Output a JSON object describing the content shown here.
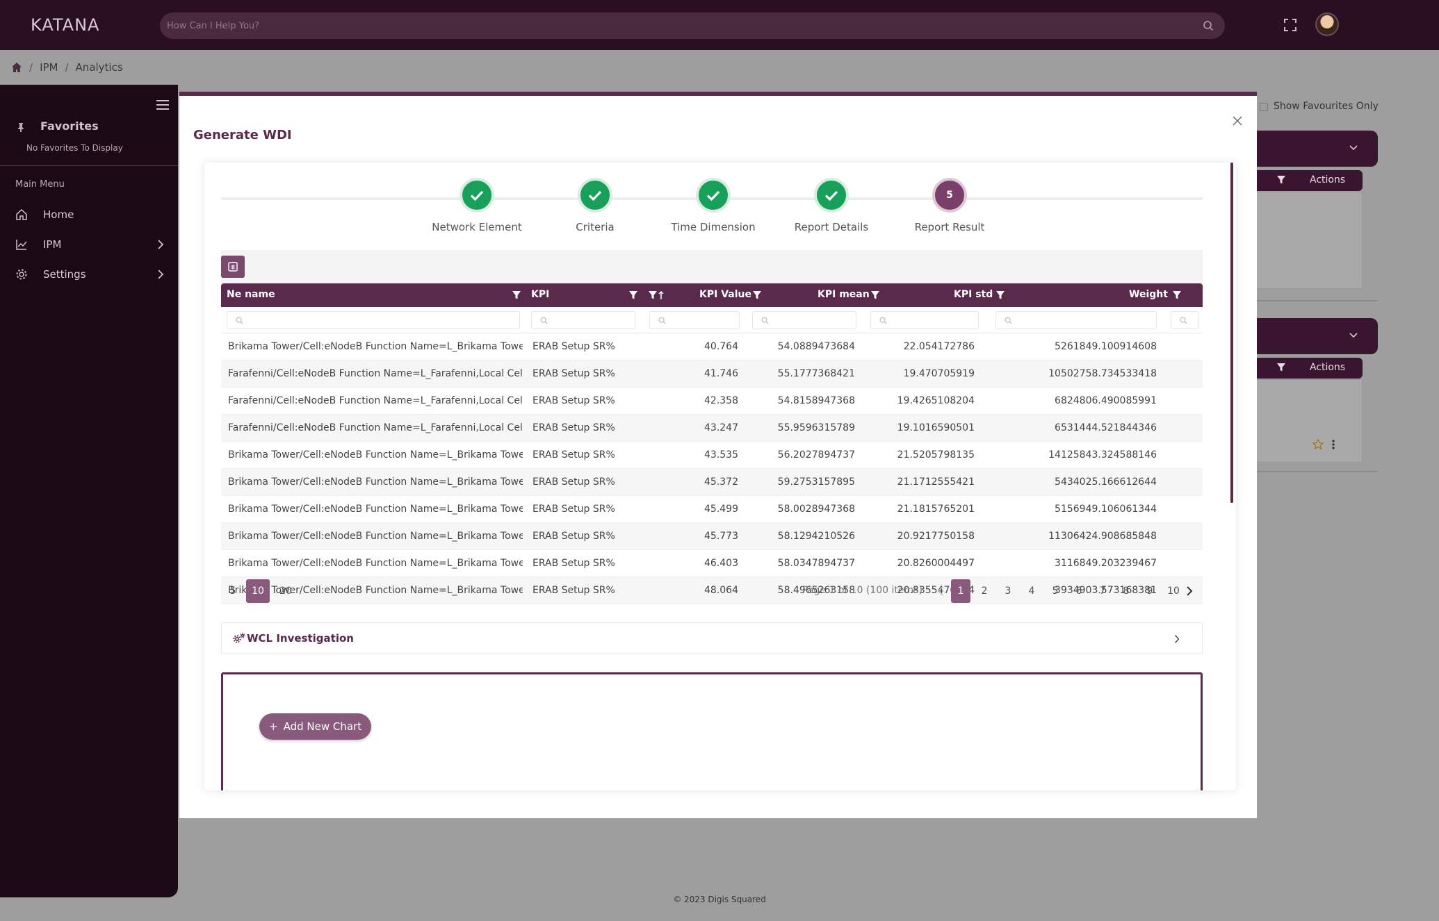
{
  "app": {
    "logo": "KATANA"
  },
  "search": {
    "placeholder": "How Can I Help You?"
  },
  "breadcrumb": {
    "items": [
      "IPM",
      "Analytics"
    ]
  },
  "sidebar": {
    "favorites_title": "Favorites",
    "favorites_empty": "No Favorites To Display",
    "main_menu_label": "Main Menu",
    "items": [
      {
        "label": "Home"
      },
      {
        "label": "IPM"
      },
      {
        "label": "Settings"
      }
    ]
  },
  "background": {
    "show_favourites_label": "Show Favourites Only",
    "actions_label": "Actions"
  },
  "modal": {
    "title": "Generate WDI",
    "steps": [
      {
        "label": "Network Element",
        "status": "done"
      },
      {
        "label": "Criteria",
        "status": "done"
      },
      {
        "label": "Time Dimension",
        "status": "done"
      },
      {
        "label": "Report Details",
        "status": "done"
      },
      {
        "label": "Report Result",
        "status": "current",
        "number": "5"
      }
    ],
    "table": {
      "columns": [
        "Ne name",
        "KPI",
        "KPI Value",
        "KPI mean",
        "KPI std",
        "Weight"
      ],
      "rows": [
        [
          "Brikama Tower/Cell:eNodeB Function Name=L_Brikama Tower,...",
          "ERAB Setup SR%",
          "40.764",
          "54.0889473684",
          "22.054172786",
          "5261849.100914608"
        ],
        [
          "Farafenni/Cell:eNodeB Function Name=L_Farafenni,Local Cell I...",
          "ERAB Setup SR%",
          "41.746",
          "55.1777368421",
          "19.470705919",
          "10502758.734533418"
        ],
        [
          "Farafenni/Cell:eNodeB Function Name=L_Farafenni,Local Cell I...",
          "ERAB Setup SR%",
          "42.358",
          "54.8158947368",
          "19.4265108204",
          "6824806.490085991"
        ],
        [
          "Farafenni/Cell:eNodeB Function Name=L_Farafenni,Local Cell I...",
          "ERAB Setup SR%",
          "43.247",
          "55.9596315789",
          "19.1016590501",
          "6531444.521844346"
        ],
        [
          "Brikama Tower/Cell:eNodeB Function Name=L_Brikama Tower,...",
          "ERAB Setup SR%",
          "43.535",
          "56.2027894737",
          "21.5205798135",
          "14125843.324588146"
        ],
        [
          "Brikama Tower/Cell:eNodeB Function Name=L_Brikama Tower,...",
          "ERAB Setup SR%",
          "45.372",
          "59.2753157895",
          "21.1712555421",
          "5434025.166612644"
        ],
        [
          "Brikama Tower/Cell:eNodeB Function Name=L_Brikama Tower,...",
          "ERAB Setup SR%",
          "45.499",
          "58.0028947368",
          "21.1815765201",
          "5156949.106061344"
        ],
        [
          "Brikama Tower/Cell:eNodeB Function Name=L_Brikama Tower,...",
          "ERAB Setup SR%",
          "45.773",
          "58.1294210526",
          "20.9217750158",
          "11306424.908685848"
        ],
        [
          "Brikama Tower/Cell:eNodeB Function Name=L_Brikama Tower,...",
          "ERAB Setup SR%",
          "46.403",
          "58.0347894737",
          "20.8260004497",
          "3116849.203239467"
        ],
        [
          "Brikama Tower/Cell:eNodeB Function Name=L_Brikama Tower,...",
          "ERAB Setup SR%",
          "48.064",
          "58.4965263158",
          "20.8355470194",
          "3934903.573168381"
        ]
      ]
    },
    "pager": {
      "sizes": [
        "5",
        "10",
        "20"
      ],
      "selected_size": "10",
      "info": "Page 1 of 10 (100 items)",
      "pages": [
        "1",
        "2",
        "3",
        "4",
        "5",
        "6",
        "7",
        "8",
        "9",
        "10"
      ],
      "current_page": "1"
    },
    "wcl_label": "WCL Investigation",
    "add_chart_label": "Add New Chart",
    "add_chart_plus": "+"
  },
  "footer": {
    "text": "© 2023 Digis Squared"
  },
  "colors": {
    "primary": "#5a2a4c",
    "accent": "#8a5a7c",
    "success": "#18a05a",
    "topbar": "#2a0f22",
    "sidebar": "#1b0a16"
  },
  "icons": [
    "search-icon",
    "expand-icon",
    "home-icon",
    "hamburger-icon",
    "pin-icon",
    "chart-icon",
    "gear-icon",
    "chevron-right-icon",
    "chevron-down-icon",
    "filter-icon",
    "export-icon",
    "check-icon",
    "close-icon",
    "star-icon",
    "more-icon",
    "gears-icon"
  ]
}
